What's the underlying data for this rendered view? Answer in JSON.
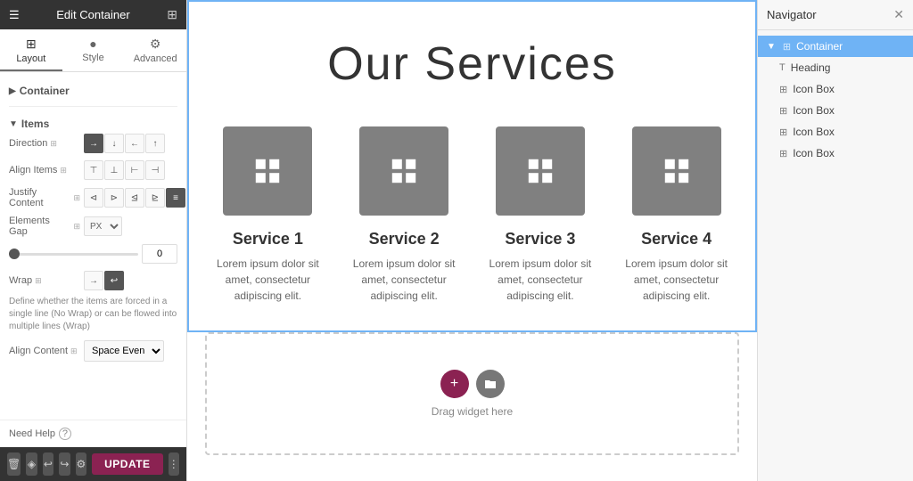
{
  "left_panel": {
    "title": "Edit Container",
    "tabs": [
      {
        "label": "Layout",
        "icon": "⊞"
      },
      {
        "label": "Style",
        "icon": "●"
      },
      {
        "label": "Advanced",
        "icon": "⚙"
      }
    ],
    "sections": {
      "container": {
        "label": "Container"
      },
      "items": {
        "label": "Items",
        "props": {
          "direction": "Direction",
          "align_items": "Align Items",
          "justify_content": "Justify Content",
          "elements_gap": "Elements Gap",
          "wrap": "Wrap",
          "wrap_hint": "Define whether the items are forced in a single line (No Wrap) or can be flowed into multiple lines (Wrap)",
          "align_content": "Align Content",
          "align_content_value": "Space Evenly"
        }
      }
    },
    "gap_value": "0",
    "gap_unit": "PX",
    "need_help": "Need Help",
    "footer": {
      "update_label": "UPDATE"
    }
  },
  "canvas": {
    "toolbar": {
      "add": "+",
      "grid": "⊞",
      "close": "✕"
    },
    "title": "Our Services",
    "services": [
      {
        "name": "Service 1",
        "desc": "Lorem ipsum dolor sit amet, consectetur adipiscing elit."
      },
      {
        "name": "Service 2",
        "desc": "Lorem ipsum dolor sit amet, consectetur adipiscing elit."
      },
      {
        "name": "Service 3",
        "desc": "Lorem ipsum dolor sit amet, consectetur adipiscing elit."
      },
      {
        "name": "Service 4",
        "desc": "Lorem ipsum dolor sit amet, consectetur adipiscing elit."
      }
    ],
    "drop_zone_text": "Drag widget here"
  },
  "navigator": {
    "title": "Navigator",
    "items": [
      {
        "label": "Container",
        "indent": 0,
        "active": true,
        "has_arrow": true
      },
      {
        "label": "Heading",
        "indent": 1,
        "active": false
      },
      {
        "label": "Icon Box",
        "indent": 1,
        "active": false
      },
      {
        "label": "Icon Box",
        "indent": 1,
        "active": false
      },
      {
        "label": "Icon Box",
        "indent": 1,
        "active": false
      },
      {
        "label": "Icon Box",
        "indent": 1,
        "active": false
      }
    ]
  }
}
